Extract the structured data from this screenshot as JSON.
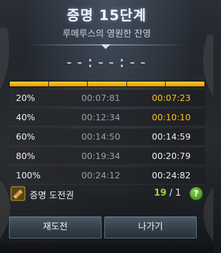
{
  "header": {
    "title": "증명 15단계",
    "subtitle": "루메루스의 영원한 잔영"
  },
  "timer": {
    "display": "--:--:--"
  },
  "progress": {
    "fill_fraction": 1.0,
    "color": "#f2b400"
  },
  "records": [
    {
      "percent": "20%",
      "best": "00:07:81",
      "current": "00:07:23",
      "current_highlight": true
    },
    {
      "percent": "40%",
      "best": "00:12:34",
      "current": "00:10:10",
      "current_highlight": true
    },
    {
      "percent": "60%",
      "best": "00:14:50",
      "current": "00:14:59",
      "current_highlight": false
    },
    {
      "percent": "80%",
      "best": "00:19:34",
      "current": "00:20:79",
      "current_highlight": false
    },
    {
      "percent": "100%",
      "best": "00:24:12",
      "current": "00:24:82",
      "current_highlight": false
    }
  ],
  "ticket": {
    "icon": "ticket-icon",
    "label": "증명 도전권",
    "have": "19",
    "separator": " / ",
    "need": "1",
    "help": "?"
  },
  "buttons": {
    "retry": "재도전",
    "exit": "나가기"
  },
  "colors": {
    "highlight": "#ffc21a",
    "have_count": "#9ad83b",
    "help_button": "#5fb02e"
  }
}
